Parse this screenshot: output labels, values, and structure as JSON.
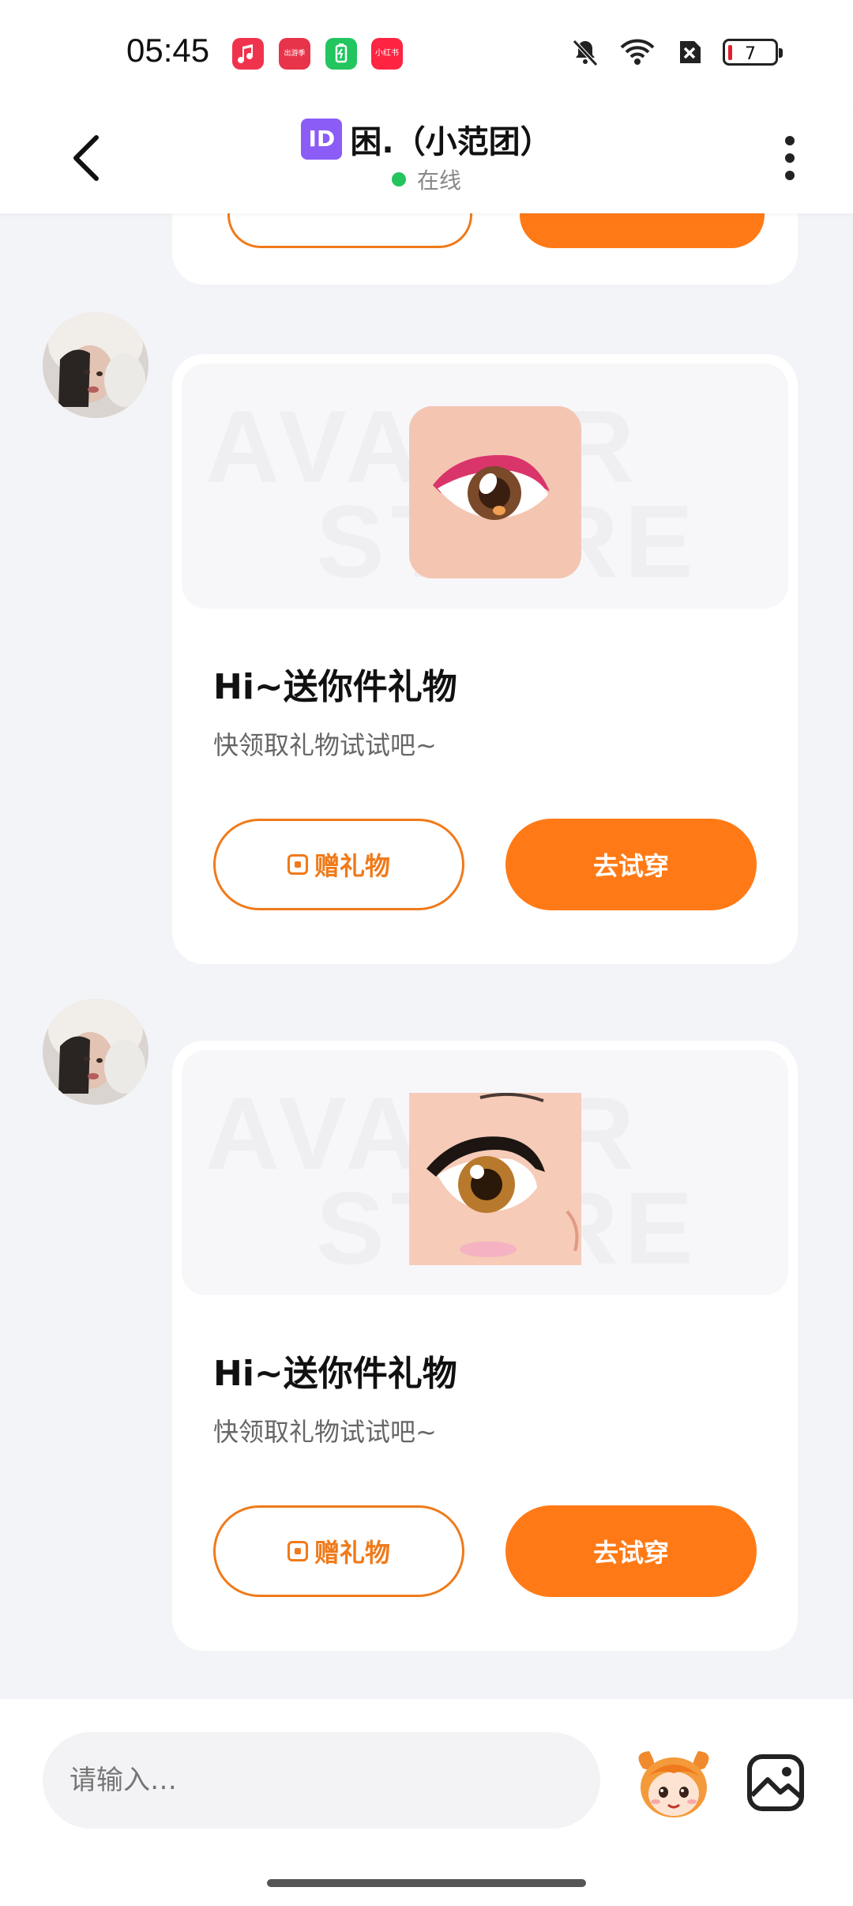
{
  "status_bar": {
    "time": "05:45",
    "battery_level": "7",
    "app_icons": [
      "music-icon",
      "game-app-icon",
      "battery-saver-icon",
      "xiaohongshu-icon"
    ],
    "xiaohongshu_label": "小红书",
    "game_label": "出游季"
  },
  "header": {
    "id_badge": "ID",
    "title": "困.（小范团）",
    "status": "在线"
  },
  "messages": [
    {
      "title": "Hi~送你件礼物",
      "subtitle": "快领取礼物试试吧~",
      "gift_button": "赠礼物",
      "try_button": "去试穿",
      "watermark": [
        "AVATAR",
        "STORE"
      ]
    },
    {
      "title": "Hi~送你件礼物",
      "subtitle": "快领取礼物试试吧~",
      "gift_button": "赠礼物",
      "try_button": "去试穿",
      "watermark": [
        "AVATAR",
        "STORE"
      ]
    }
  ],
  "input": {
    "placeholder": "请输入…"
  },
  "colors": {
    "accent": "#ff7a16",
    "online": "#22c55e",
    "badge": "#8b5cf6"
  }
}
